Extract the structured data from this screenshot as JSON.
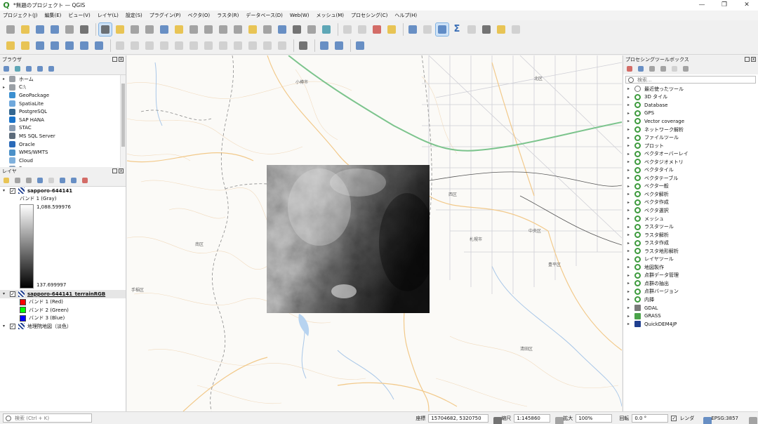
{
  "window": {
    "title": "*無題のプロジェクト — QGIS",
    "minimize": "—",
    "maximize": "❐",
    "close": "✕"
  },
  "menu": [
    "プロジェクト(J)",
    "編集(E)",
    "ビュー(V)",
    "レイヤ(L)",
    "設定(S)",
    "プラグイン(P)",
    "ベクタ(O)",
    "ラスタ(R)",
    "データベース(D)",
    "Web(W)",
    "メッシュ(M)",
    "プロセシング(C)",
    "ヘルプ(H)"
  ],
  "browser_panel": {
    "title": "ブラウザ",
    "items": [
      {
        "label": "ホーム",
        "expand": "▸",
        "color": "#9aa0a6"
      },
      {
        "label": "C:\\",
        "expand": "▸",
        "color": "#9aa0a6"
      },
      {
        "label": "GeoPackage",
        "expand": "",
        "color": "#3b8fd0"
      },
      {
        "label": "SpatiaLite",
        "expand": "",
        "color": "#6fa8dc"
      },
      {
        "label": "PostgreSQL",
        "expand": "",
        "color": "#336791"
      },
      {
        "label": "SAP HANA",
        "expand": "",
        "color": "#1a73c9"
      },
      {
        "label": "STAC",
        "expand": "",
        "color": "#8a9bb0"
      },
      {
        "label": "MS SQL Server",
        "expand": "",
        "color": "#5c6b7a"
      },
      {
        "label": "Oracle",
        "expand": "",
        "color": "#2a6ab8"
      },
      {
        "label": "WMS/WMTS",
        "expand": "",
        "color": "#4a90c8"
      },
      {
        "label": "Cloud",
        "expand": "",
        "color": "#7fb0dc"
      },
      {
        "label": "Scenes",
        "expand": "",
        "color": "#8fa6c0"
      }
    ]
  },
  "layers_panel": {
    "title": "レイヤ",
    "layer1": {
      "name": "sapporo-644141",
      "expand": "▾",
      "check": "✓",
      "band": "バンド 1 (Gray)",
      "max": "1,088.599976",
      "min": "137.699997"
    },
    "layer2": {
      "name": "sapporo-644141_terrainRGB",
      "expand": "▾",
      "check": "✓",
      "bands": [
        {
          "label": "バンド 1 (Red)",
          "color": "#ff0000"
        },
        {
          "label": "バンド 2 (Green)",
          "color": "#00ff00"
        },
        {
          "label": "バンド 3 (Blue)",
          "color": "#0000ff"
        }
      ]
    },
    "layer3": {
      "name": "地理院地図（淡色）",
      "expand": "▾",
      "check": "✓"
    }
  },
  "processing_panel": {
    "title": "プロセシングツールボックス",
    "search_placeholder": "検索...",
    "items": [
      {
        "label": "最近使ったツール",
        "icon": "clock"
      },
      {
        "label": "3D タイル",
        "icon": "q"
      },
      {
        "label": "Database",
        "icon": "q"
      },
      {
        "label": "GPS",
        "icon": "q"
      },
      {
        "label": "Vector coverage",
        "icon": "q"
      },
      {
        "label": "ネットワーク解析",
        "icon": "q"
      },
      {
        "label": "ファイルツール",
        "icon": "q"
      },
      {
        "label": "プロット",
        "icon": "q"
      },
      {
        "label": "ベクタオーバーレイ",
        "icon": "q"
      },
      {
        "label": "ベクタジオメトリ",
        "icon": "q"
      },
      {
        "label": "ベクタタイル",
        "icon": "q"
      },
      {
        "label": "ベクタテーブル",
        "icon": "q"
      },
      {
        "label": "ベクタ一般",
        "icon": "q"
      },
      {
        "label": "ベクタ解析",
        "icon": "q"
      },
      {
        "label": "ベクタ作成",
        "icon": "q"
      },
      {
        "label": "ベクタ選択",
        "icon": "q"
      },
      {
        "label": "メッシュ",
        "icon": "q"
      },
      {
        "label": "ラスタツール",
        "icon": "q"
      },
      {
        "label": "ラスタ解析",
        "icon": "q"
      },
      {
        "label": "ラスタ作成",
        "icon": "q"
      },
      {
        "label": "ラスタ地形解析",
        "icon": "q"
      },
      {
        "label": "レイヤツール",
        "icon": "q"
      },
      {
        "label": "地図製作",
        "icon": "q"
      },
      {
        "label": "点群データ管理",
        "icon": "q"
      },
      {
        "label": "点群の抽出",
        "icon": "q"
      },
      {
        "label": "点群バージョン",
        "icon": "q"
      },
      {
        "label": "内挿",
        "icon": "q"
      },
      {
        "label": "GDAL",
        "icon": "gdal"
      },
      {
        "label": "GRASS",
        "icon": "grass"
      },
      {
        "label": "QuickDEM4JP",
        "icon": "qd"
      }
    ]
  },
  "map": {
    "labels": [
      "小樽市",
      "北区",
      "中央区",
      "西区",
      "南区",
      "札幌市",
      "豊平区",
      "清田区",
      "手稲区"
    ]
  },
  "statusbar": {
    "search_placeholder": "検索 (Ctrl + K)",
    "coord_label": "座標",
    "coord_value": "15704682, 5320750",
    "scale_label": "縮尺",
    "scale_value": "1:145860",
    "zoom_label": "拡大",
    "zoom_value": "100%",
    "rotation_label": "回転",
    "rotation_value": "0.0 °",
    "render_label": "レンダ",
    "render_check": "✓",
    "crs": "EPSG:3857"
  }
}
